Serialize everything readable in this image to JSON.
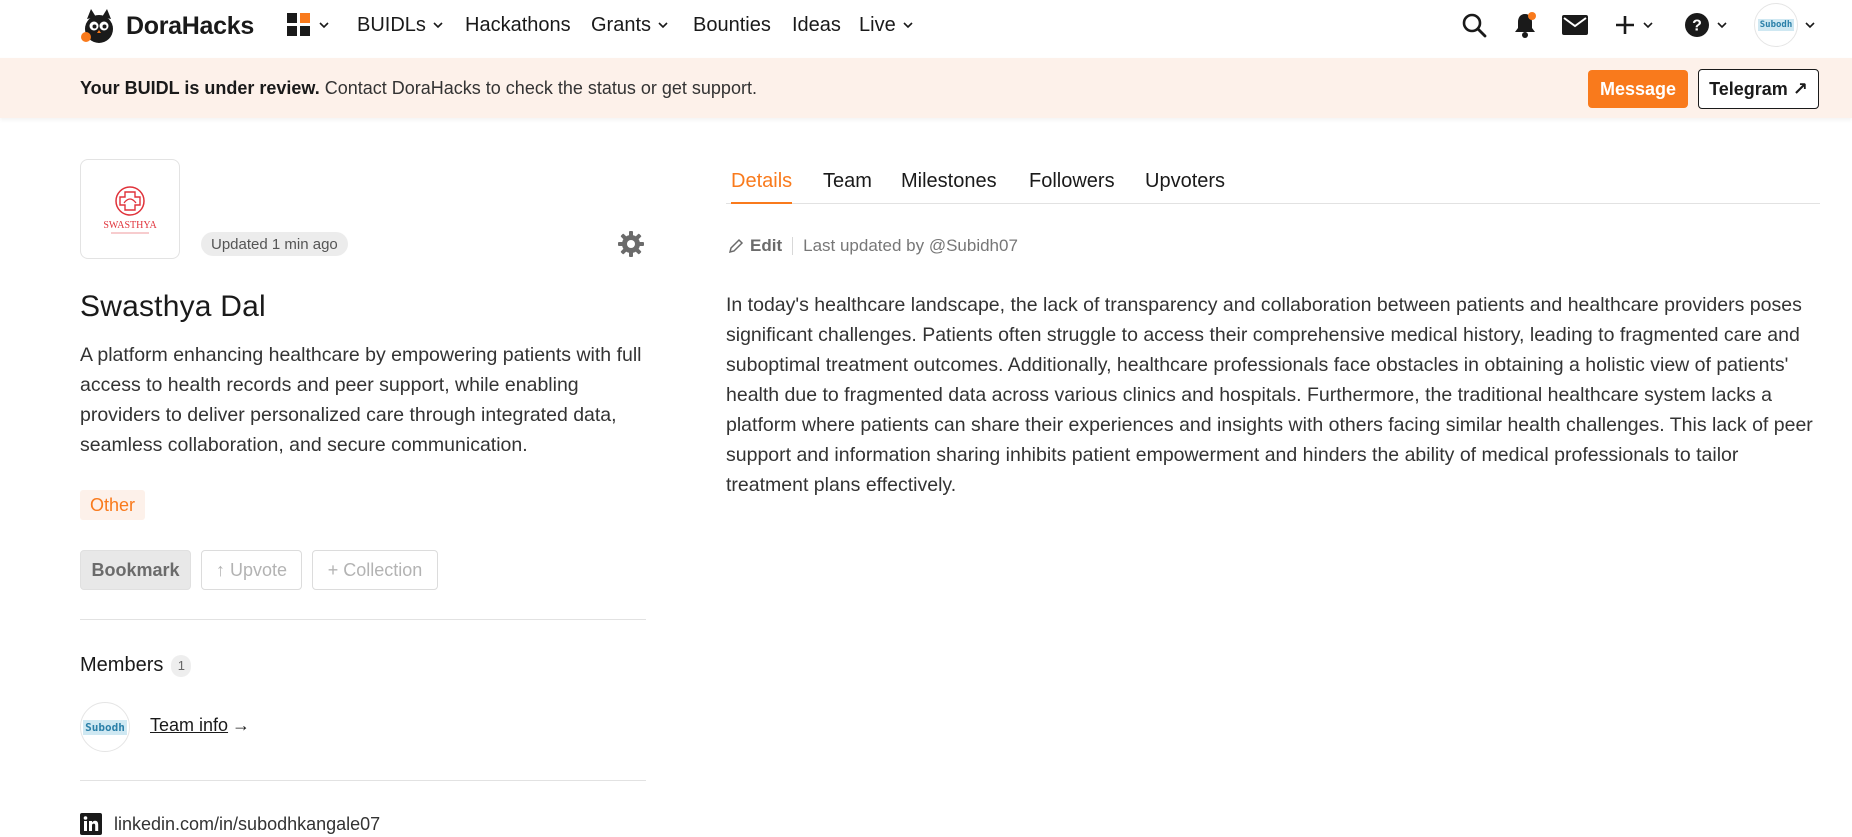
{
  "nav": {
    "brand": "DoraHacks",
    "items": [
      {
        "label": "BUIDLs",
        "dropdown": true
      },
      {
        "label": "Hackathons",
        "dropdown": false
      },
      {
        "label": "Grants",
        "dropdown": true
      },
      {
        "label": "Bounties",
        "dropdown": false
      },
      {
        "label": "Ideas",
        "dropdown": false
      },
      {
        "label": "Live",
        "dropdown": true
      }
    ],
    "user_avatar_text": "Subodh",
    "icons": [
      "apps-grid-icon",
      "search-icon",
      "bell-icon",
      "mail-icon",
      "plus-icon",
      "help-icon"
    ],
    "notification_dot_color": "#f97a1c"
  },
  "banner": {
    "bold": "Your BUIDL is under review.",
    "text": " Contact DoraHacks to check the status or get support.",
    "message_label": "Message",
    "telegram_label": "Telegram ↗"
  },
  "project": {
    "logo_text": "SWASTHYA",
    "updated": "Updated 1 min ago",
    "name": "Swasthya Dal",
    "description": "A platform enhancing healthcare by empowering patients with full access to health records and peer support, while enabling providers to deliver personalized care through integrated data, seamless collaboration, and secure communication.",
    "tag": "Other",
    "bookmark_label": "Bookmark",
    "upvote_label": "↑ Upvote",
    "collection_label": "+ Collection"
  },
  "members": {
    "title": "Members",
    "count": "1",
    "avatar_text": "Subodh",
    "team_info": "Team info",
    "arrow": "→"
  },
  "social": {
    "linkedin": "linkedin.com/in/subodhkangale07"
  },
  "tabs": [
    "Details",
    "Team",
    "Milestones",
    "Followers",
    "Upvoters"
  ],
  "details": {
    "edit_label": "Edit",
    "last_updated": "Last updated by @Subidh07",
    "body": "In today's healthcare landscape, the lack of transparency and collaboration between patients and healthcare providers poses significant challenges. Patients often struggle to access their comprehensive medical history, leading to fragmented care and suboptimal treatment outcomes. Additionally, healthcare professionals face obstacles in obtaining a holistic view of patients' health due to fragmented data across various clinics and hospitals. Furthermore, the traditional healthcare system lacks a platform where patients can share their experiences and insights with others facing similar health challenges. This lack of peer support and information sharing inhibits patient empowerment and hinders the ability of medical professionals to tailor treatment plans effectively."
  },
  "colors": {
    "accent": "#f97a1c",
    "banner_bg": "#fdf1ea",
    "logo_red": "#e0323a"
  }
}
